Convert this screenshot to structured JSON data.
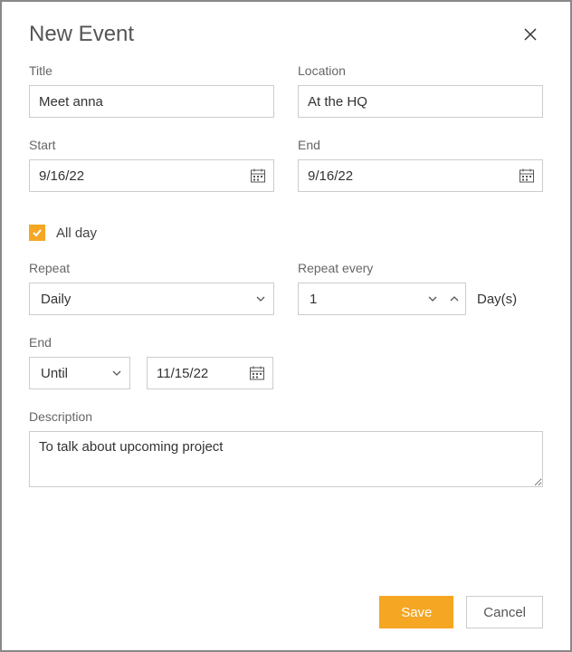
{
  "header": {
    "title": "New Event"
  },
  "colors": {
    "accent": "#f5a623"
  },
  "fields": {
    "title": {
      "label": "Title",
      "value": "Meet anna"
    },
    "location": {
      "label": "Location",
      "value": "At the HQ"
    },
    "start": {
      "label": "Start",
      "value": "9/16/22"
    },
    "end_date": {
      "label": "End",
      "value": "9/16/22"
    },
    "allday": {
      "label": "All day",
      "checked": true
    },
    "repeat": {
      "label": "Repeat",
      "value": "Daily"
    },
    "repeat_every": {
      "label": "Repeat every",
      "value": "1",
      "unit": "Day(s)"
    },
    "end_condition": {
      "label": "End",
      "mode": "Until",
      "until_date": "11/15/22"
    },
    "description": {
      "label": "Description",
      "value": "To talk about upcoming project"
    }
  },
  "buttons": {
    "save": "Save",
    "cancel": "Cancel"
  }
}
